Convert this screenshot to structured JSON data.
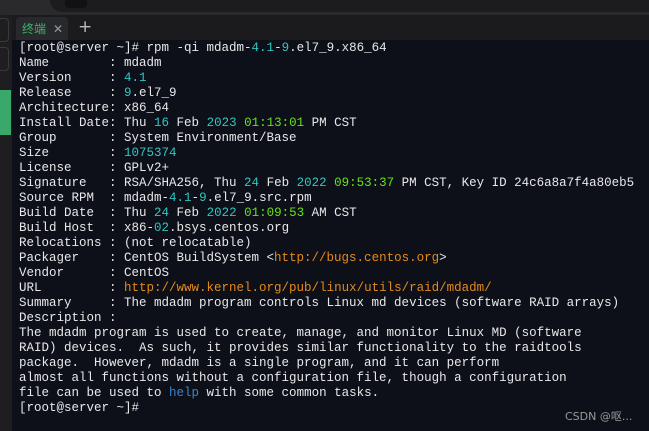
{
  "tabs": [
    {
      "label": "终端",
      "active": true
    }
  ],
  "colors": {
    "normal": "#e8e8e8",
    "cyan": "#2fc6c0",
    "green": "#66e01a",
    "orange": "#e48a1c",
    "blue": "#3c84cc"
  },
  "terminal": {
    "lines": [
      [
        [
          "[root@server ~]# rpm -qi mdadm-",
          "n"
        ],
        [
          "4.1",
          "c"
        ],
        [
          "-",
          "n"
        ],
        [
          "9",
          "c"
        ],
        [
          ".el7_9.x86_64",
          "n"
        ]
      ],
      [
        [
          "Name        : mdadm",
          "n"
        ]
      ],
      [
        [
          "Version     : ",
          "n"
        ],
        [
          "4.1",
          "c"
        ]
      ],
      [
        [
          "Release     : ",
          "n"
        ],
        [
          "9",
          "c"
        ],
        [
          ".el7_9",
          "n"
        ]
      ],
      [
        [
          "Architecture: x86_64",
          "n"
        ]
      ],
      [
        [
          "Install Date: Thu ",
          "n"
        ],
        [
          "16",
          "c"
        ],
        [
          " Feb ",
          "n"
        ],
        [
          "2023",
          "c"
        ],
        [
          " ",
          "n"
        ],
        [
          "01:13:01",
          "g"
        ],
        [
          " PM CST",
          "n"
        ]
      ],
      [
        [
          "Group       : System Environment/Base",
          "n"
        ]
      ],
      [
        [
          "Size        : ",
          "n"
        ],
        [
          "1075374",
          "c"
        ]
      ],
      [
        [
          "License     : GPLv2+",
          "n"
        ]
      ],
      [
        [
          "Signature   : RSA/SHA256, Thu ",
          "n"
        ],
        [
          "24",
          "c"
        ],
        [
          " Feb ",
          "n"
        ],
        [
          "2022",
          "c"
        ],
        [
          " ",
          "n"
        ],
        [
          "09:53:37",
          "g"
        ],
        [
          " PM CST, Key ID 24c6a8a7f4a80eb5",
          "n"
        ]
      ],
      [
        [
          "Source RPM  : mdadm-",
          "n"
        ],
        [
          "4.1",
          "c"
        ],
        [
          "-",
          "n"
        ],
        [
          "9",
          "c"
        ],
        [
          ".el7_9.src.rpm",
          "n"
        ]
      ],
      [
        [
          "Build Date  : Thu ",
          "n"
        ],
        [
          "24",
          "c"
        ],
        [
          " Feb ",
          "n"
        ],
        [
          "2022",
          "c"
        ],
        [
          " ",
          "n"
        ],
        [
          "01:09:53",
          "g"
        ],
        [
          " AM CST",
          "n"
        ]
      ],
      [
        [
          "Build Host  : x86-",
          "n"
        ],
        [
          "02",
          "c"
        ],
        [
          ".bsys.centos.org",
          "n"
        ]
      ],
      [
        [
          "Relocations : (not relocatable)",
          "n"
        ]
      ],
      [
        [
          "Packager    : CentOS BuildSystem <",
          "n"
        ],
        [
          "http://bugs.centos.org",
          "o"
        ],
        [
          ">",
          "n"
        ]
      ],
      [
        [
          "Vendor      : CentOS",
          "n"
        ]
      ],
      [
        [
          "URL         : ",
          "n"
        ],
        [
          "http://www.kernel.org/pub/linux/utils/raid/mdadm/",
          "o"
        ]
      ],
      [
        [
          "Summary     : The mdadm program controls Linux md devices (software RAID arrays)",
          "n"
        ]
      ],
      [
        [
          "Description :",
          "n"
        ]
      ],
      [
        [
          "The mdadm program is used to create, manage, and monitor Linux MD (software",
          "n"
        ]
      ],
      [
        [
          "RAID) devices.  As such, it provides similar functionality to the raidtools",
          "n"
        ]
      ],
      [
        [
          "package.  However, mdadm is a single program, and it can perform",
          "n"
        ]
      ],
      [
        [
          "almost all functions without a configuration file, though a configuration",
          "n"
        ]
      ],
      [
        [
          "file can be used to ",
          "n"
        ],
        [
          "help",
          "b"
        ],
        [
          " with some common tasks.",
          "n"
        ]
      ],
      [
        [
          "[root@server ~]#",
          "n"
        ]
      ]
    ]
  },
  "watermark": "CSDN @呕..."
}
